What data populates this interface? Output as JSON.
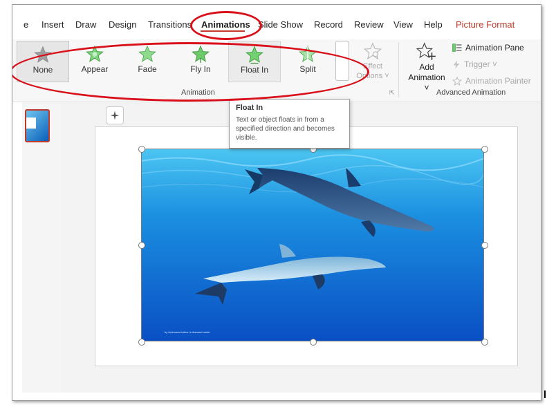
{
  "ribbon_tabs": [
    {
      "label": "e",
      "active": false
    },
    {
      "label": "Insert",
      "active": false
    },
    {
      "label": "Draw",
      "active": false
    },
    {
      "label": "Design",
      "active": false
    },
    {
      "label": "Transitions",
      "active": false
    },
    {
      "label": "Animations",
      "active": true
    },
    {
      "label": "Slide Show",
      "active": false
    },
    {
      "label": "Record",
      "active": false
    },
    {
      "label": "Review",
      "active": false
    },
    {
      "label": "View",
      "active": false
    },
    {
      "label": "Help",
      "active": false
    },
    {
      "label": "Picture Format",
      "active": false
    }
  ],
  "animation_gallery": {
    "items": [
      {
        "label": "None",
        "icon": "star-gray-icon",
        "state": "selected"
      },
      {
        "label": "Appear",
        "icon": "star-burst-green-icon",
        "state": "normal"
      },
      {
        "label": "Fade",
        "icon": "star-green-icon",
        "state": "normal"
      },
      {
        "label": "Fly In",
        "icon": "star-fly-green-icon",
        "state": "normal"
      },
      {
        "label": "Float In",
        "icon": "star-float-green-icon",
        "state": "hover"
      },
      {
        "label": "Split",
        "icon": "star-split-green-icon",
        "state": "normal"
      }
    ],
    "group_label": "Animation"
  },
  "effect_options": {
    "line1": "Effect",
    "line2": "Options ˅",
    "enabled": false
  },
  "advanced_animation": {
    "add_animation": {
      "line1": "Add",
      "line2": "Animation ˅"
    },
    "animation_pane": "Animation Pane",
    "trigger": "Trigger ˅",
    "animation_painter": "Animation Painter",
    "group_label": "Advanced Animation"
  },
  "tooltip": {
    "title": "Float In",
    "body": "Text or object floats in from a specified direction and becomes visible."
  },
  "image": {
    "credit": "by Unknown Author is licensed under"
  },
  "colors": {
    "accent_red": "#c0392b",
    "annotation_red": "#d9101a",
    "star_green": "#5cb85c",
    "star_gray": "#9e9e9e"
  }
}
